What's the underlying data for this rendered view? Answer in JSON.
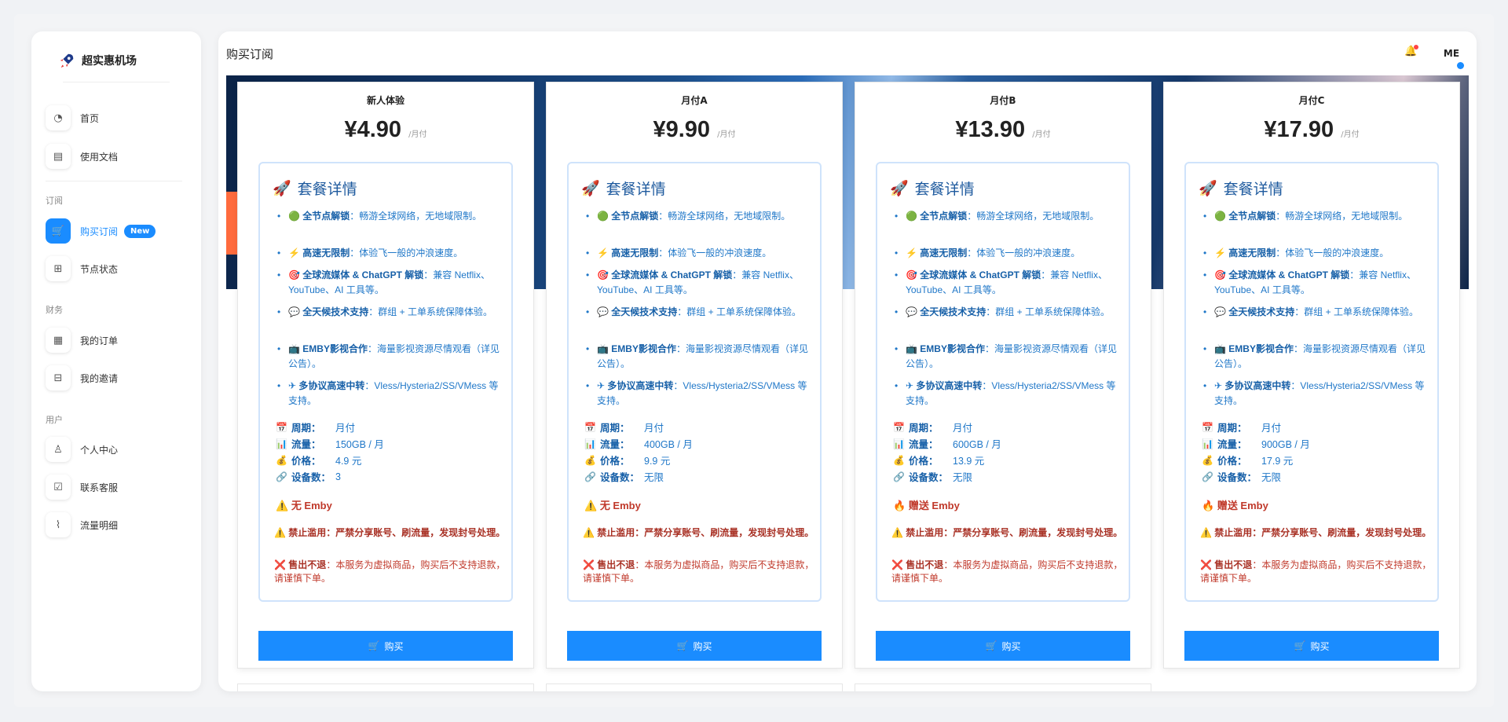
{
  "brand": {
    "name": "超实惠机场"
  },
  "sidebar": {
    "items_top": [
      {
        "label": "首页",
        "icon": "dashboard-icon"
      },
      {
        "label": "使用文档",
        "icon": "document-icon"
      }
    ],
    "section_subscribe": "订阅",
    "items_subscribe": [
      {
        "label": "购买订阅",
        "icon": "cart-icon",
        "badge": "New"
      },
      {
        "label": "节点状态",
        "icon": "grid-icon"
      }
    ],
    "section_finance": "财务",
    "items_finance": [
      {
        "label": "我的订单",
        "icon": "clipboard-icon"
      },
      {
        "label": "我的邀请",
        "icon": "gift-icon"
      }
    ],
    "section_user": "用户",
    "items_user": [
      {
        "label": "个人中心",
        "icon": "user-icon"
      },
      {
        "label": "联系客服",
        "icon": "support-icon"
      },
      {
        "label": "流量明细",
        "icon": "activity-icon"
      }
    ]
  },
  "header": {
    "title": "购买订阅",
    "avatar": "ME"
  },
  "plans": [
    {
      "name": "新人体验",
      "price": "¥4.90",
      "period": "/月付",
      "cycle": "月付",
      "traffic": "150GB / 月",
      "cost": "4.9 元",
      "devices": "3",
      "emby": "无 Emby",
      "emby_icon": "warning"
    },
    {
      "name": "月付A",
      "price": "¥9.90",
      "period": "/月付",
      "cycle": "月付",
      "traffic": "400GB / 月",
      "cost": "9.9 元",
      "devices": "无限",
      "emby": "无 Emby",
      "emby_icon": "warning"
    },
    {
      "name": "月付B",
      "price": "¥13.90",
      "period": "/月付",
      "cycle": "月付",
      "traffic": "600GB / 月",
      "cost": "13.9 元",
      "devices": "无限",
      "emby": "赠送 Emby",
      "emby_icon": "fire"
    },
    {
      "name": "月付C",
      "price": "¥17.90",
      "period": "/月付",
      "cycle": "月付",
      "traffic": "900GB / 月",
      "cost": "17.9 元",
      "devices": "无限",
      "emby": "赠送 Emby",
      "emby_icon": "fire"
    }
  ],
  "details": {
    "title": "套餐详情",
    "features": [
      {
        "icon": "globe-icon",
        "title": "全节点解锁",
        "text": "：畅游全球网络，无地域限制。"
      },
      {
        "icon": "lightning-icon",
        "title": "高速无限制",
        "text": "：体验飞一般的冲浪速度。"
      },
      {
        "icon": "target-icon",
        "title": "全球流媒体 & ChatGPT 解锁",
        "text": "：兼容 Netflix、YouTube、AI 工具等。"
      },
      {
        "icon": "chat-icon",
        "title": "全天候技术支持",
        "text": "：群组 + 工单系统保障体验。"
      },
      {
        "icon": "tv-icon",
        "title": "EMBY影视合作",
        "text": "：海量影视资源尽情观看（详见公告）。"
      },
      {
        "icon": "plane-icon",
        "title": "多协议高速中转",
        "text": "：Vless/Hysteria2/SS/VMess 等支持。"
      }
    ],
    "spec_labels": {
      "cycle": "周期：",
      "traffic": "流量：",
      "cost": "价格：",
      "devices": "设备数："
    },
    "warn_abuse_title": "禁止滥用：严禁分享账号、刷流量，发现封号处理。",
    "warn_refund_title": "售出不退",
    "warn_refund_text": "：本服务为虚拟商品，购买后不支持退款，请谨慎下单。",
    "buy_label": "购买"
  },
  "colors": {
    "accent": "#1a8cff",
    "detail_text": "#1f77c8",
    "warning": "#c0392b"
  }
}
